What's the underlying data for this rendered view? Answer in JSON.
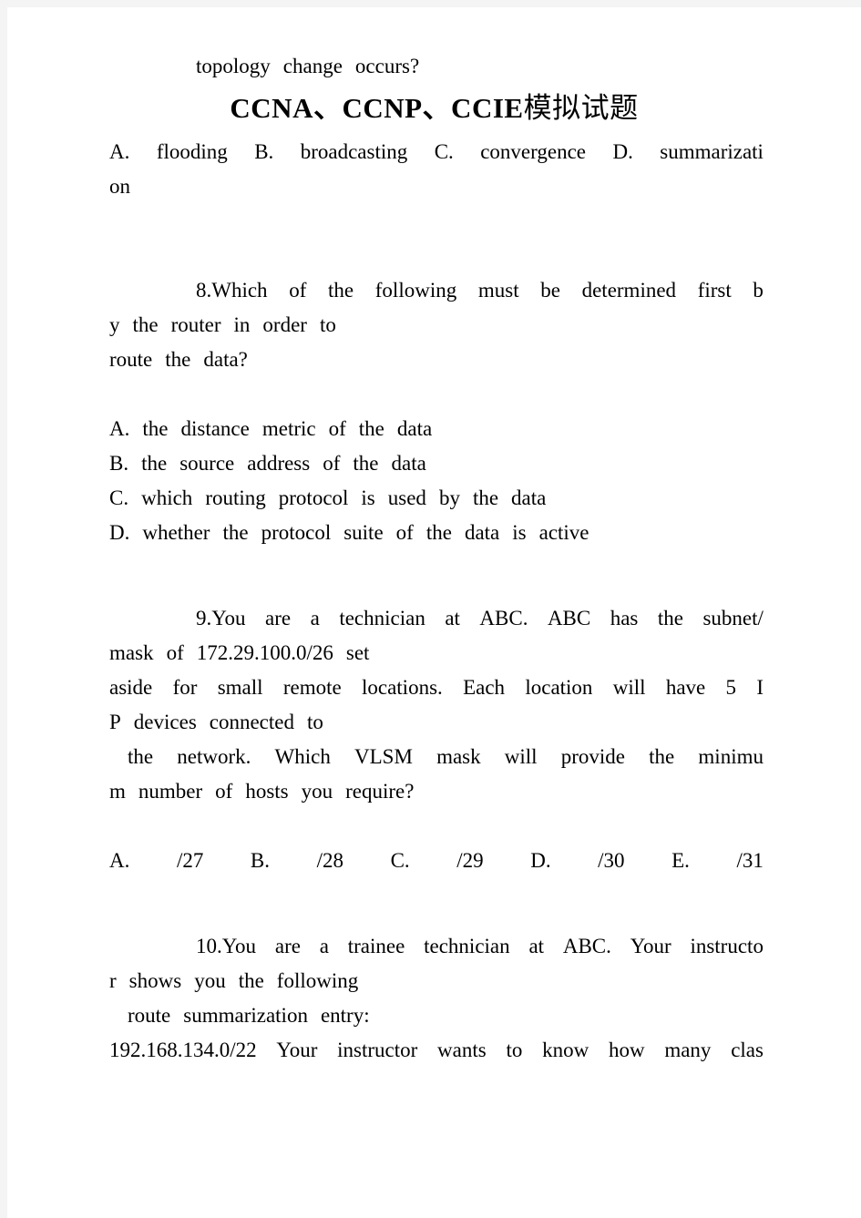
{
  "document": {
    "title_latin": "CCNA、CCNP、CCIE",
    "title_cjk": "模拟试题",
    "page_background": "#ffffff",
    "outer_background": "#f4f4f4",
    "text_color": "#000000"
  },
  "body": {
    "q7_tail": {
      "lines": [
        {
          "words": [
            "topology",
            "change",
            "occurs?"
          ],
          "justify": false,
          "indent": "question"
        }
      ]
    },
    "q7_options": {
      "lines": [
        {
          "words": [
            "A.",
            "flooding",
            "B.",
            "broadcasting",
            "C.",
            "convergence",
            "D.",
            "summarizati"
          ],
          "justify": true,
          "indent": "none"
        },
        {
          "words": [
            "on"
          ],
          "justify": false,
          "indent": "none"
        }
      ]
    },
    "q8_stem": {
      "lines": [
        {
          "words": [
            "8.Which",
            "of",
            "the",
            "following",
            "must",
            "be",
            "determined",
            "first",
            "b"
          ],
          "justify": true,
          "indent": "question"
        },
        {
          "words": [
            "y",
            "the",
            "router",
            "in",
            "order",
            "to"
          ],
          "justify": false,
          "indent": "none"
        },
        {
          "words": [
            "route",
            "the",
            "data?"
          ],
          "justify": false,
          "indent": "none"
        }
      ]
    },
    "q8_options": {
      "lines": [
        {
          "words": [
            "A.",
            "the",
            "distance",
            "metric",
            "of",
            "the",
            "data"
          ],
          "justify": false,
          "indent": "none"
        },
        {
          "words": [
            "B.",
            "the",
            "source",
            "address",
            "of",
            "the",
            "data"
          ],
          "justify": false,
          "indent": "none"
        },
        {
          "words": [
            "C.",
            "which",
            "routing",
            "protocol",
            "is",
            "used",
            "by",
            "the",
            "data"
          ],
          "justify": false,
          "indent": "none"
        },
        {
          "words": [
            "D.",
            "whether",
            "the",
            "protocol",
            "suite",
            "of",
            "the",
            "data",
            "is",
            "active"
          ],
          "justify": false,
          "indent": "none"
        }
      ]
    },
    "q9_stem": {
      "lines": [
        {
          "words": [
            "9.You",
            "are",
            "a",
            "technician",
            "at",
            "ABC.",
            "ABC",
            "has",
            "the",
            "subnet/"
          ],
          "justify": true,
          "indent": "question"
        },
        {
          "words": [
            "mask",
            "of",
            "172.29.100.0/26",
            "set"
          ],
          "justify": false,
          "indent": "none"
        },
        {
          "words": [
            "aside",
            "for",
            "small",
            "remote",
            "locations.",
            "Each",
            "location",
            "will",
            "have",
            "5",
            "I"
          ],
          "justify": true,
          "indent": "none"
        },
        {
          "words": [
            "P",
            "devices",
            "connected",
            "to"
          ],
          "justify": false,
          "indent": "none"
        },
        {
          "words": [
            "the",
            "network.",
            "Which",
            "VLSM",
            "mask",
            "will",
            "provide",
            "the",
            "minimu"
          ],
          "justify": true,
          "indent": "small"
        },
        {
          "words": [
            "m",
            "number",
            "of",
            "hosts",
            "you",
            "require?"
          ],
          "justify": false,
          "indent": "none"
        }
      ]
    },
    "q9_options": {
      "lines": [
        {
          "words": [
            "A.",
            "/27",
            "B.",
            "/28",
            "C.",
            "/29",
            "D.",
            "/30",
            "E.",
            "/31"
          ],
          "justify": true,
          "indent": "none"
        }
      ]
    },
    "q10_stem": {
      "lines": [
        {
          "words": [
            "10.You",
            "are",
            "a",
            "trainee",
            "technician",
            "at",
            "ABC.",
            "Your",
            "instructo"
          ],
          "justify": true,
          "indent": "question"
        },
        {
          "words": [
            "r",
            "shows",
            "you",
            "the",
            "following"
          ],
          "justify": false,
          "indent": "none"
        },
        {
          "words": [
            "route",
            "summarization",
            "entry:"
          ],
          "justify": false,
          "indent": "small"
        },
        {
          "words": [
            "192.168.134.0/22",
            "Your",
            "instructor",
            "wants",
            "to",
            "know",
            "how",
            "many",
            "clas"
          ],
          "justify": true,
          "indent": "none"
        }
      ]
    }
  }
}
